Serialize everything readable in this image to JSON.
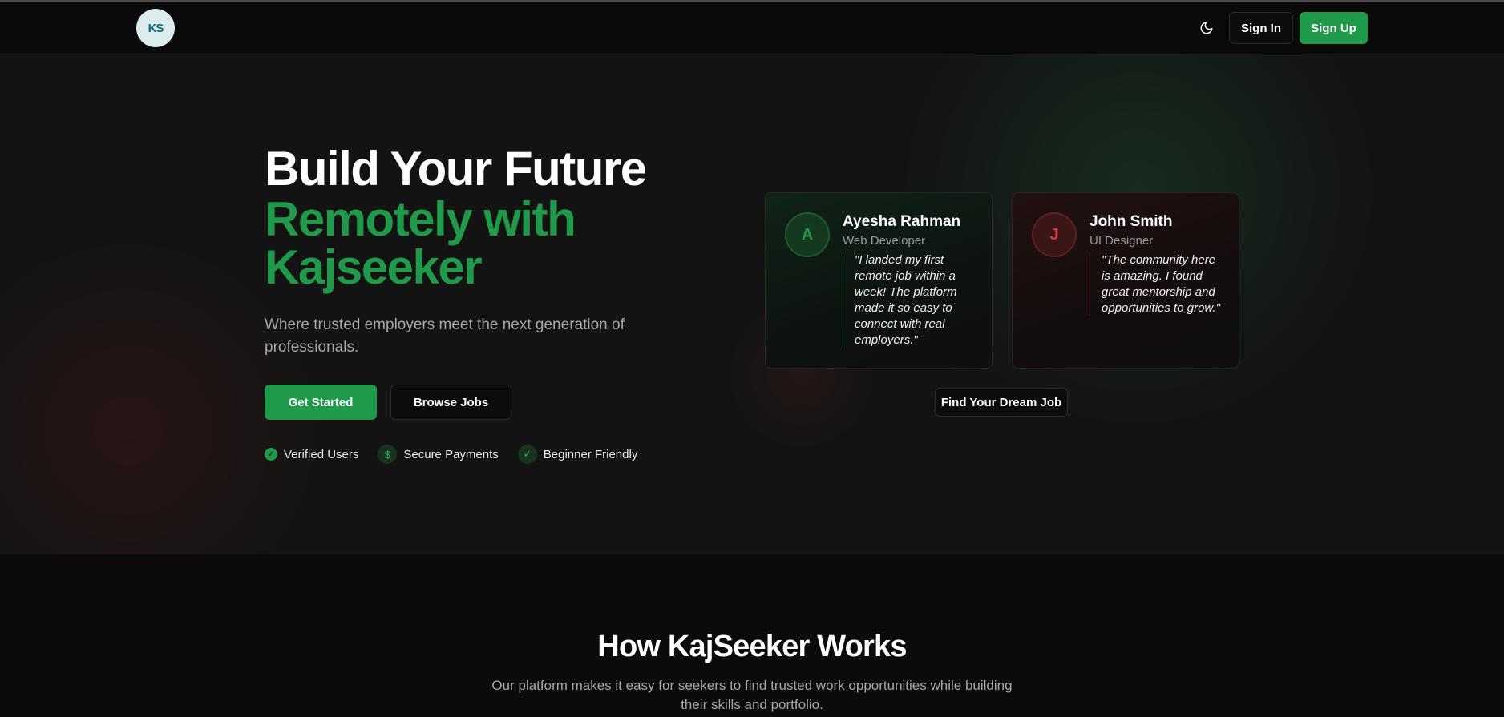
{
  "nav": {
    "logo_text": "KS",
    "theme_icon": "moon-icon",
    "sign_in": "Sign In",
    "sign_up": "Sign Up"
  },
  "hero": {
    "title_line1": "Build Your Future",
    "title_line2": "Remotely with Kajseeker",
    "subtitle": "Where trusted employers meet the next generation of professionals.",
    "cta_primary": "Get Started",
    "cta_secondary": "Browse Jobs",
    "badges": [
      {
        "icon": "check-circle-icon",
        "label": "Verified Users"
      },
      {
        "icon": "dollar-icon",
        "label": "Secure Payments",
        "glyph": "$"
      },
      {
        "icon": "check-icon",
        "label": "Beginner Friendly",
        "glyph": "✓"
      }
    ],
    "accent_color": "#21994a"
  },
  "testimonials": [
    {
      "initial": "A",
      "name": "Ayesha Rahman",
      "role": "Web Developer",
      "quote": "\"I landed my first remote job within a week! The platform made it so easy to connect with real employers.\"",
      "theme": "green"
    },
    {
      "initial": "J",
      "name": "John Smith",
      "role": "UI Designer",
      "quote": "\"The community here is amazing. I found great mentorship and opportunities to grow.\"",
      "theme": "red"
    }
  ],
  "dream_button": "Find Your Dream Job",
  "how": {
    "title": "How KajSeeker Works",
    "subtitle": "Our platform makes it easy for seekers to find trusted work opportunities while building their skills and portfolio."
  }
}
